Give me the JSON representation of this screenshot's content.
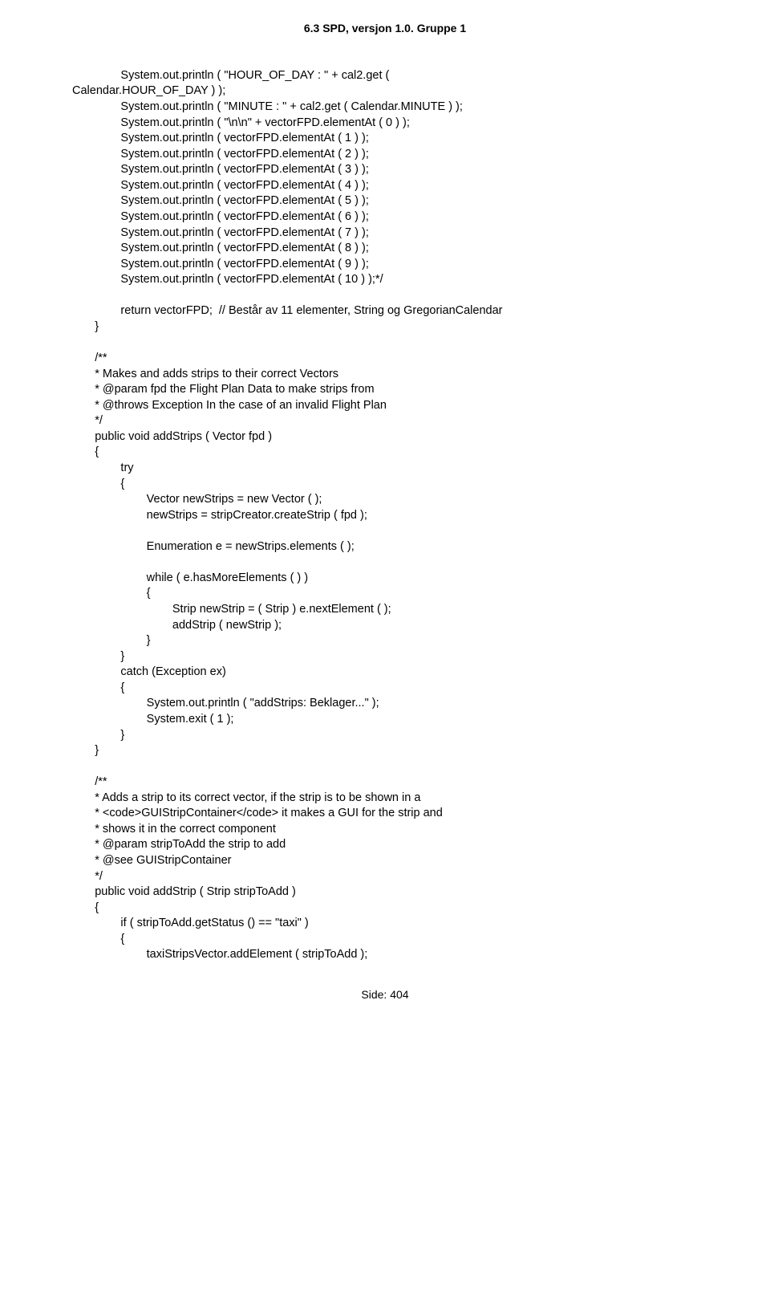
{
  "header": "6.3 SPD, versjon 1.0. Gruppe 1",
  "code_lines": [
    "               System.out.println ( \"HOUR_OF_DAY : \" + cal2.get (",
    "Calendar.HOUR_OF_DAY ) );",
    "               System.out.println ( \"MINUTE : \" + cal2.get ( Calendar.MINUTE ) );",
    "               System.out.println ( \"\\n\\n\" + vectorFPD.elementAt ( 0 ) );",
    "               System.out.println ( vectorFPD.elementAt ( 1 ) );",
    "               System.out.println ( vectorFPD.elementAt ( 2 ) );",
    "               System.out.println ( vectorFPD.elementAt ( 3 ) );",
    "               System.out.println ( vectorFPD.elementAt ( 4 ) );",
    "               System.out.println ( vectorFPD.elementAt ( 5 ) );",
    "               System.out.println ( vectorFPD.elementAt ( 6 ) );",
    "               System.out.println ( vectorFPD.elementAt ( 7 ) );",
    "               System.out.println ( vectorFPD.elementAt ( 8 ) );",
    "               System.out.println ( vectorFPD.elementAt ( 9 ) );",
    "               System.out.println ( vectorFPD.elementAt ( 10 ) );*/",
    "",
    "               return vectorFPD;  // Består av 11 elementer, String og GregorianCalendar",
    "       }",
    "",
    "       /**",
    "       * Makes and adds strips to their correct Vectors",
    "       * @param fpd the Flight Plan Data to make strips from",
    "       * @throws Exception In the case of an invalid Flight Plan",
    "       */",
    "       public void addStrips ( Vector fpd )",
    "       {",
    "               try",
    "               {",
    "                       Vector newStrips = new Vector ( );",
    "                       newStrips = stripCreator.createStrip ( fpd );",
    "",
    "                       Enumeration e = newStrips.elements ( );",
    "",
    "                       while ( e.hasMoreElements ( ) )",
    "                       {",
    "                               Strip newStrip = ( Strip ) e.nextElement ( );",
    "                               addStrip ( newStrip );",
    "                       }",
    "               }",
    "               catch (Exception ex)",
    "               {",
    "                       System.out.println ( \"addStrips: Beklager...\" );",
    "                       System.exit ( 1 );",
    "               }",
    "       }",
    "",
    "       /**",
    "       * Adds a strip to its correct vector, if the strip is to be shown in a",
    "       * <code>GUIStripContainer</code> it makes a GUI for the strip and",
    "       * shows it in the correct component",
    "       * @param stripToAdd the strip to add",
    "       * @see GUIStripContainer",
    "       */",
    "       public void addStrip ( Strip stripToAdd )",
    "       {",
    "               if ( stripToAdd.getStatus () == \"taxi\" )",
    "               {",
    "                       taxiStripsVector.addElement ( stripToAdd );"
  ],
  "footer": "Side: 404"
}
